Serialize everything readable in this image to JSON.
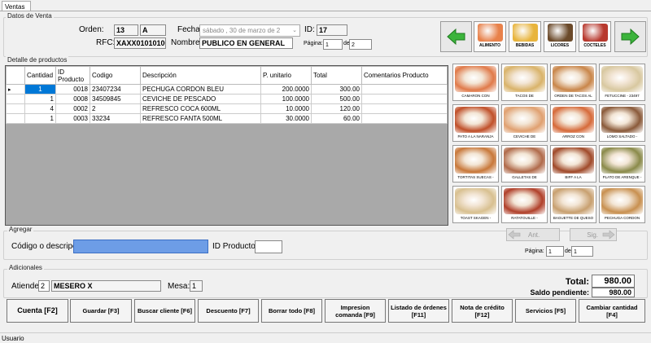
{
  "window": {
    "tab": "Ventas",
    "status_bar": "Usuario"
  },
  "datos_venta": {
    "group_label": "Datos de Venta",
    "orden_label": "Orden:",
    "orden_num": "13",
    "orden_serie": "A",
    "fecha_label": "Fecha:",
    "fecha_day": "sábado",
    "fecha_date": "30",
    "fecha_de1": "de",
    "fecha_month": "marzo",
    "fecha_de2": "de 2",
    "id_label": "ID:",
    "id_value": "17",
    "rfc_label": "RFC:",
    "rfc_value": "XAXX01010100",
    "nombre_label": "Nombre:",
    "nombre_value": "PUBLICO EN GENERAL",
    "pagina_label": "Página:",
    "pagina_value": "1",
    "pagina_de": "de",
    "pagina_total": "2"
  },
  "categories": [
    {
      "label": "ALIMENTO",
      "icon": "shrimp-food-icon",
      "color": "#e8814a"
    },
    {
      "label": "BEBIDAS",
      "icon": "bottles-icon",
      "color": "#e8b43c"
    },
    {
      "label": "LICORES",
      "icon": "liquor-bottles-icon",
      "color": "#6b4a2a"
    },
    {
      "label": "COCTELES",
      "icon": "cocktail-icon",
      "color": "#b8392e"
    }
  ],
  "detalle": {
    "group_label": "Detalle de productos",
    "columns": [
      "Cantidad",
      "ID Producto",
      "Codigo",
      "Descripción",
      "P. unitario",
      "Total",
      "Comentarios Producto"
    ],
    "rows": [
      {
        "cantidad": "1",
        "id": "0018",
        "codigo": "23407234",
        "descripcion": "PECHUGA CORDON BLEU",
        "unitario": "200.0000",
        "total": "300.00",
        "comentarios": ""
      },
      {
        "cantidad": "1",
        "id": "0008",
        "codigo": "34509845",
        "descripcion": "CEVICHE DE PESCADO",
        "unitario": "100.0000",
        "total": "500.00",
        "comentarios": ""
      },
      {
        "cantidad": "4",
        "id": "0002",
        "codigo": "2",
        "descripcion": "REFRESCO COCA 600ML",
        "unitario": "10.0000",
        "total": "120.00",
        "comentarios": ""
      },
      {
        "cantidad": "1",
        "id": "0003",
        "codigo": "33234",
        "descripcion": "REFRESCO FANTA 500ML",
        "unitario": "30.0000",
        "total": "60.00",
        "comentarios": ""
      }
    ]
  },
  "products": [
    {
      "label": "CAMARON CON",
      "color": "#e07a4a"
    },
    {
      "label": "TACOS DE",
      "color": "#d9b36a"
    },
    {
      "label": "ORDEN DE TACOS AL",
      "color": "#c9864a"
    },
    {
      "label": "FETUCCINE - 23497",
      "color": "#d8c8a0"
    },
    {
      "label": "PATO A LA NARANJA",
      "color": "#c0502a"
    },
    {
      "label": "CEVICHE DE",
      "color": "#e0a070"
    },
    {
      "label": "ARROZ CON",
      "color": "#d66a3a"
    },
    {
      "label": "LOMO SALTADO -",
      "color": "#8a5a3a"
    },
    {
      "label": "TORTITAS SUECAS -",
      "color": "#c8783a"
    },
    {
      "label": "GALLETAS DE",
      "color": "#b06a4a"
    },
    {
      "label": "BIFF A LA",
      "color": "#a04a2a"
    },
    {
      "label": "PLATO DE ARENQUE -",
      "color": "#8a8a4a"
    },
    {
      "label": "TOAST SKAGEN -",
      "color": "#d8c090"
    },
    {
      "label": "RATATOUILLE -",
      "color": "#b0402a"
    },
    {
      "label": "BAGUETTE DE QUESO",
      "color": "#c8a070"
    },
    {
      "label": "PECHUGA CORDON",
      "color": "#c89050"
    }
  ],
  "agregar": {
    "group_label": "Agregar",
    "codigo_label": "Código o descripción:",
    "codigo_value": "",
    "id_label": "ID Producto:",
    "id_value": "",
    "ant_label": "Ant.",
    "sig_label": "Sig.",
    "pagina_label": "Página:",
    "pagina_value": "1",
    "pagina_de": "de",
    "pagina_total": "1"
  },
  "adicionales": {
    "group_label": "Adicionales",
    "atiende_label": "Atiende:",
    "atiende_num": "2",
    "atiende_name": "MESERO X",
    "mesa_label": "Mesa:",
    "mesa_value": "1"
  },
  "totals": {
    "total_label": "Total:",
    "total_value": "980.00",
    "saldo_label": "Saldo pendiente:",
    "saldo_value": "980.00"
  },
  "buttons": [
    {
      "name": "cuenta-button",
      "line1": "Cuenta [F2]",
      "line2": ""
    },
    {
      "name": "guardar-button",
      "line1": "Guardar [F3]",
      "line2": ""
    },
    {
      "name": "buscar-cliente-button",
      "line1": "Buscar cliente [F6]",
      "line2": ""
    },
    {
      "name": "descuento-button",
      "line1": "Descuento [F7]",
      "line2": ""
    },
    {
      "name": "borrar-todo-button",
      "line1": "Borrar todo [F8]",
      "line2": ""
    },
    {
      "name": "impresion-comanda-button",
      "line1": "Impresion",
      "line2": "comanda [F9]"
    },
    {
      "name": "listado-ordenes-button",
      "line1": "Listado  de órdenes",
      "line2": "[F11]"
    },
    {
      "name": "nota-credito-button",
      "line1": "Nota de crédito",
      "line2": "[F12]"
    },
    {
      "name": "servicios-button",
      "line1": "Servicios [F5]",
      "line2": ""
    },
    {
      "name": "cambiar-cantidad-button",
      "line1": "Cambiar cantidad",
      "line2": "[F4]"
    }
  ]
}
